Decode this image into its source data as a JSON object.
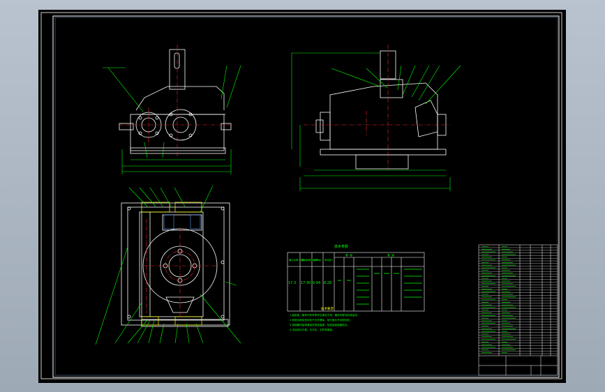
{
  "drawing": {
    "colors": {
      "background": "#000000",
      "frame": "#ffffff",
      "outline": "#ffffff",
      "centerline": "#ff2a2a",
      "dimension": "#00ff00",
      "leader": "#00ff00",
      "annotation": "#ffff00",
      "table_text": "#00ff00",
      "table_lines": "#ffffff"
    },
    "views": [
      "front-view",
      "side-view",
      "top-view"
    ],
    "table_title": "技术参数",
    "technical_params": {
      "headers": [
        "输入功率 P(kW)",
        "输入转速 n(r/min)",
        "效率 η",
        "传动比 i",
        "第一级",
        "第二级"
      ],
      "row": [
        "17.3",
        "17.30",
        "0.94",
        "8.28"
      ]
    },
    "notes_title": "技术要求",
    "notes": [
      "1.装配前，箱体内所有零件应清洗干净，箱体内壁涂防锈油漆。",
      "2.各配合面及密封处不允许漏油，剖分面允许涂密封胶。",
      "3.减速器内装润滑油至规定高度，检查齿面接触斑点。",
      "4.试运转应平稳，无冲击，无异常噪音。"
    ]
  }
}
